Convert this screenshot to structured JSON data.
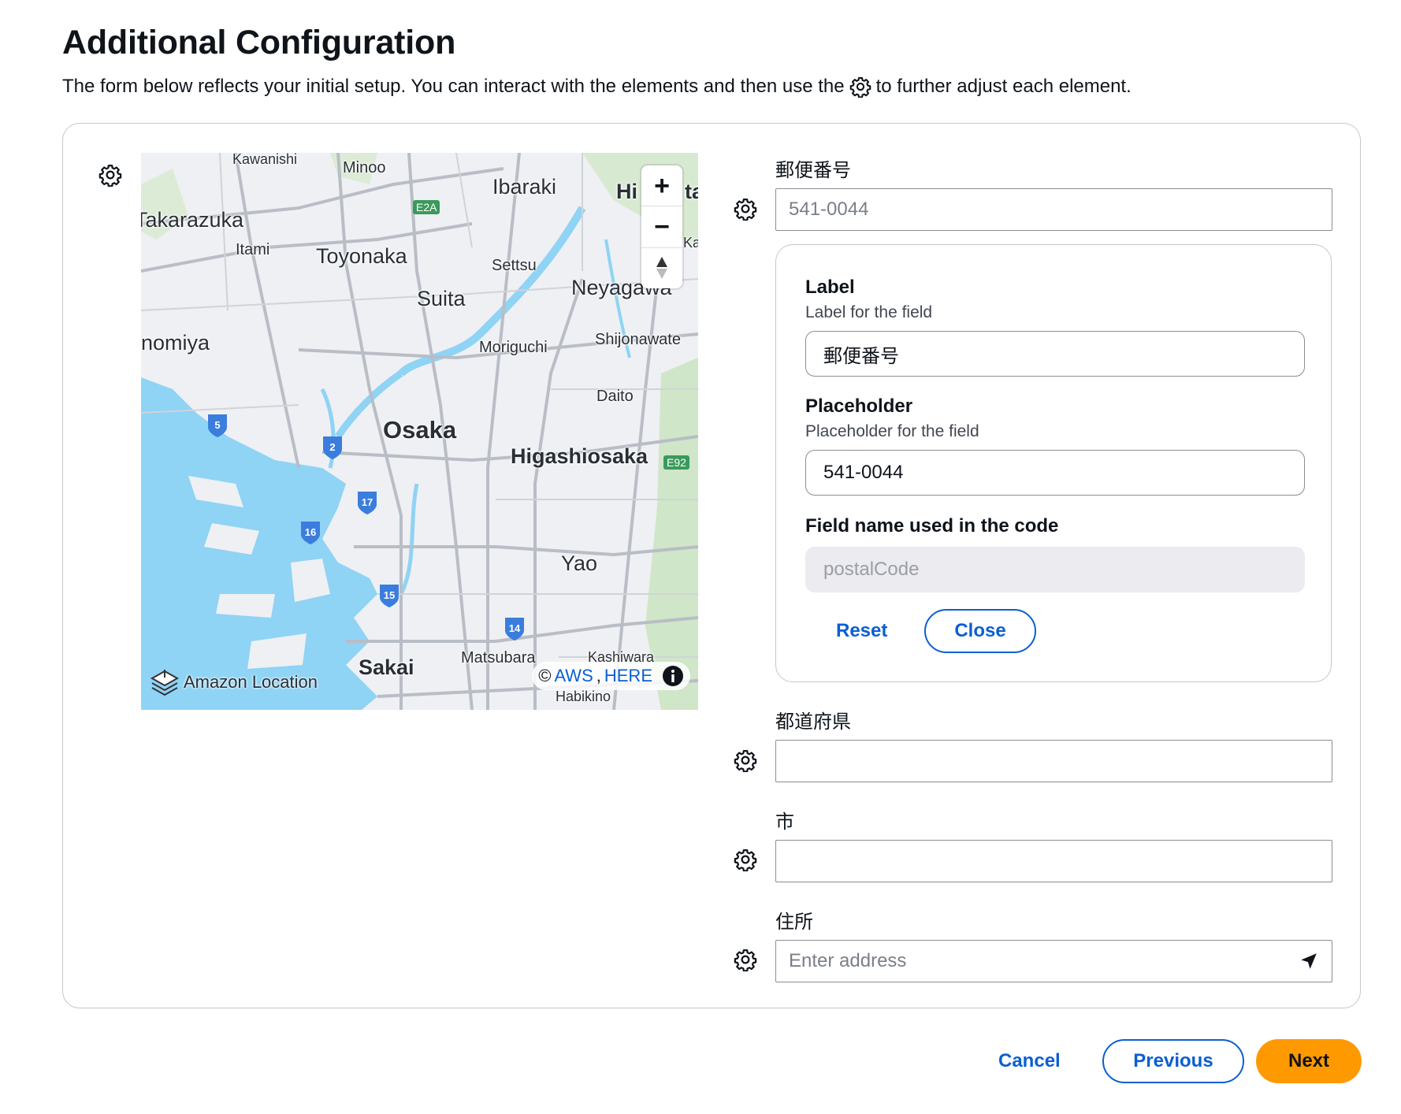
{
  "header": {
    "title": "Additional Configuration",
    "description_before": "The form below reflects your initial setup. You can interact with the elements and then use the",
    "description_after": "to further adjust each element."
  },
  "map": {
    "labels": [
      "Kawanishi",
      "Minoo",
      "Ibaraki",
      "Hi",
      "ta",
      "Takarazuka",
      "Itami",
      "Toyonaka",
      "Settsu",
      "Ka",
      "Suita",
      "Neyagawa",
      "Nishinomiya",
      "Moriguchi",
      "Shijonawate",
      "Daito",
      "Osaka",
      "Higashiosaka",
      "Yao",
      "Sakai",
      "Matsubara",
      "Kashiwara",
      "Habikino"
    ],
    "expressway_badges": [
      "E2A",
      "E92"
    ],
    "route_shields": [
      "5",
      "2",
      "17",
      "16",
      "15",
      "14"
    ],
    "attribution_left": "Amazon Location",
    "attribution_copyright": "©",
    "attribution_aws": "AWS",
    "attribution_sep": ",",
    "attribution_here": "HERE",
    "zoom_in": "+",
    "zoom_out": "−"
  },
  "fields": {
    "postal": {
      "label": "郵便番号",
      "placeholder": "541-0044"
    },
    "prefecture": {
      "label": "都道府県",
      "value": ""
    },
    "city": {
      "label": "市",
      "value": ""
    },
    "address": {
      "label": "住所",
      "placeholder": "Enter address"
    }
  },
  "popover": {
    "label_title": "Label",
    "label_sub": "Label for the field",
    "label_value": "郵便番号",
    "placeholder_title": "Placeholder",
    "placeholder_sub": "Placeholder for the field",
    "placeholder_value": "541-0044",
    "fieldname_title": "Field name used in the code",
    "fieldname_value": "postalCode",
    "reset": "Reset",
    "close": "Close"
  },
  "footer": {
    "cancel": "Cancel",
    "previous": "Previous",
    "next": "Next"
  },
  "colors": {
    "accent": "#0a5fd1",
    "primary": "#ff9900",
    "water": "#8fd3f5",
    "route_shield": "#3b7ddd"
  },
  "icons": {
    "settings": "gear-icon",
    "location": "navigation-arrow-icon",
    "info": "info-icon",
    "compass": "compass-icon",
    "logo": "amazon-location-logo-icon"
  }
}
